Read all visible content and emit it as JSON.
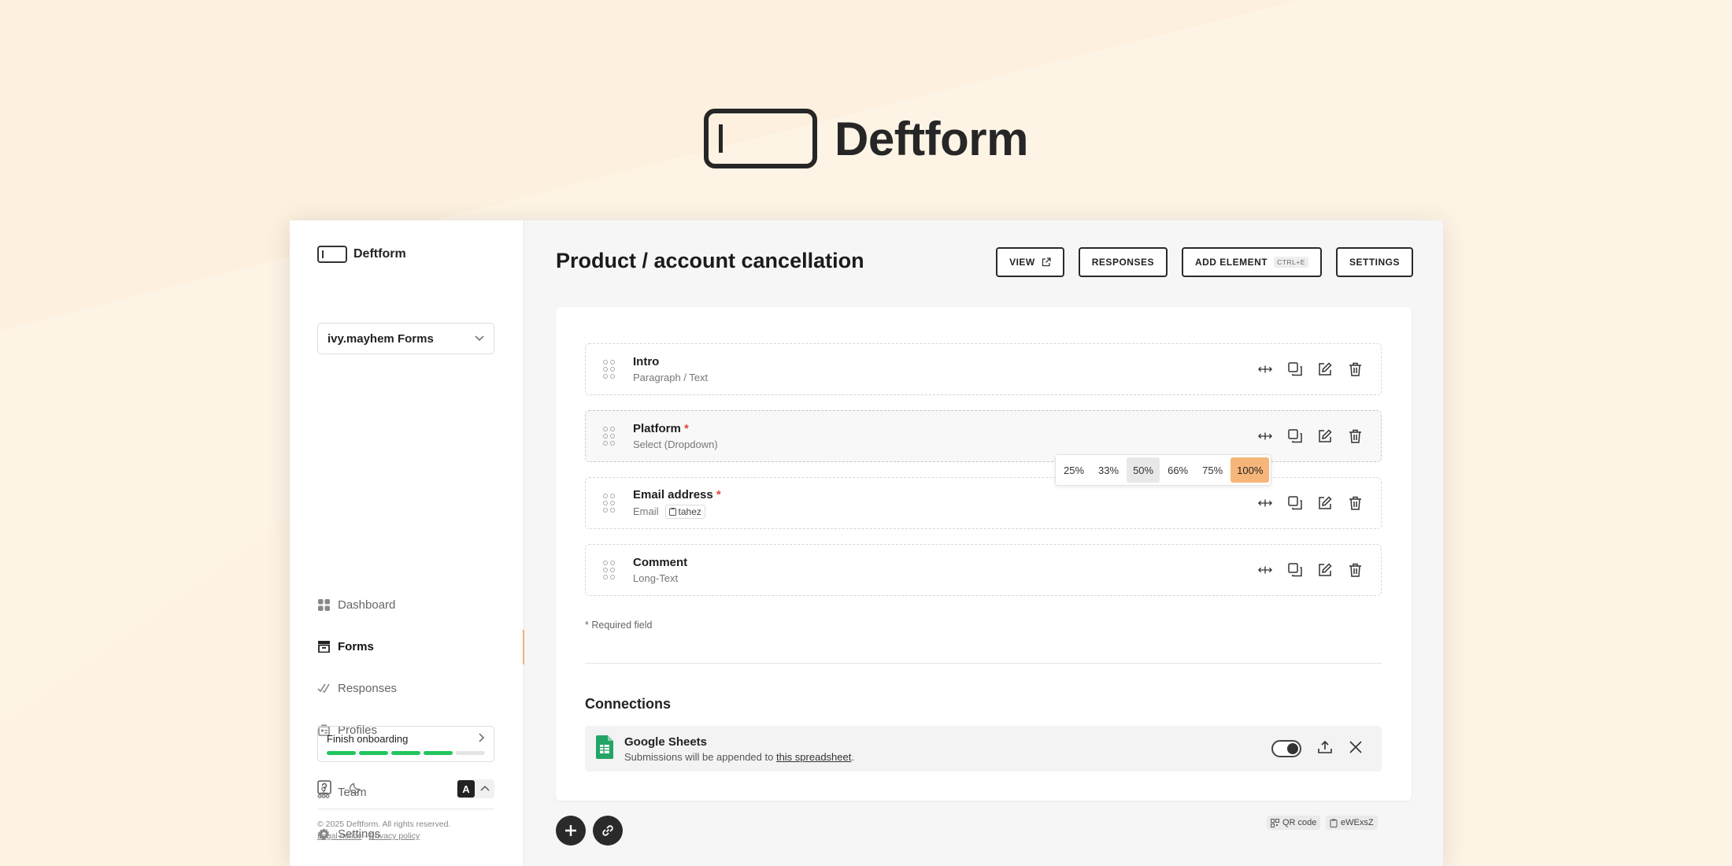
{
  "hero": {
    "brand": "Deftform"
  },
  "sidebar": {
    "brand": "Deftform",
    "workspace": "ivy.mayhem Forms",
    "nav": [
      {
        "label": "Dashboard",
        "icon": "dashboard-icon"
      },
      {
        "label": "Forms",
        "icon": "forms-icon",
        "active": true
      },
      {
        "label": "Responses",
        "icon": "check-icon"
      },
      {
        "label": "Profiles",
        "icon": "profiles-icon"
      },
      {
        "label": "Team",
        "icon": "team-icon"
      },
      {
        "label": "Settings",
        "icon": "gear-icon"
      }
    ],
    "onboarding": {
      "label": "Finish onboarding",
      "steps_done": 4,
      "steps_total": 5
    },
    "lang": "A",
    "footer": {
      "copyright": "© 2025 Deftform. All rights reserved.",
      "legal": "Legal notice",
      "separator": " - ",
      "privacy": "Privacy policy"
    }
  },
  "main": {
    "title": "Product / account cancellation",
    "toolbar": {
      "view": "VIEW",
      "responses": "RESPONSES",
      "add_element": "ADD ELEMENT",
      "shortcut": "CTRL+E",
      "settings": "SETTINGS"
    },
    "fields": [
      {
        "label": "Intro",
        "required": false,
        "type": "Paragraph / Text"
      },
      {
        "label": "Platform",
        "required": true,
        "type": "Select (Dropdown)"
      },
      {
        "label": "Email address",
        "required": true,
        "type": "Email",
        "tag": "tahez"
      },
      {
        "label": "Comment",
        "required": false,
        "type": "Long-Text"
      }
    ],
    "required_mark": "*",
    "width_options": [
      "25%",
      "33%",
      "50%",
      "66%",
      "75%",
      "100%"
    ],
    "width_selected": "100%",
    "width_hover": "50%",
    "required_note": "* Required field",
    "connections": {
      "title": "Connections",
      "items": [
        {
          "name": "Google Sheets",
          "desc_prefix": "Submissions will be appended to ",
          "link": "this spreadsheet",
          "desc_suffix": ".",
          "enabled": true
        }
      ]
    },
    "chips": {
      "qr": "QR code",
      "id": "eWExsZ"
    }
  },
  "colors": {
    "accent": "#f6b679",
    "progress": "#22c55e",
    "required": "#e0443e",
    "background": "#fdf0df"
  }
}
